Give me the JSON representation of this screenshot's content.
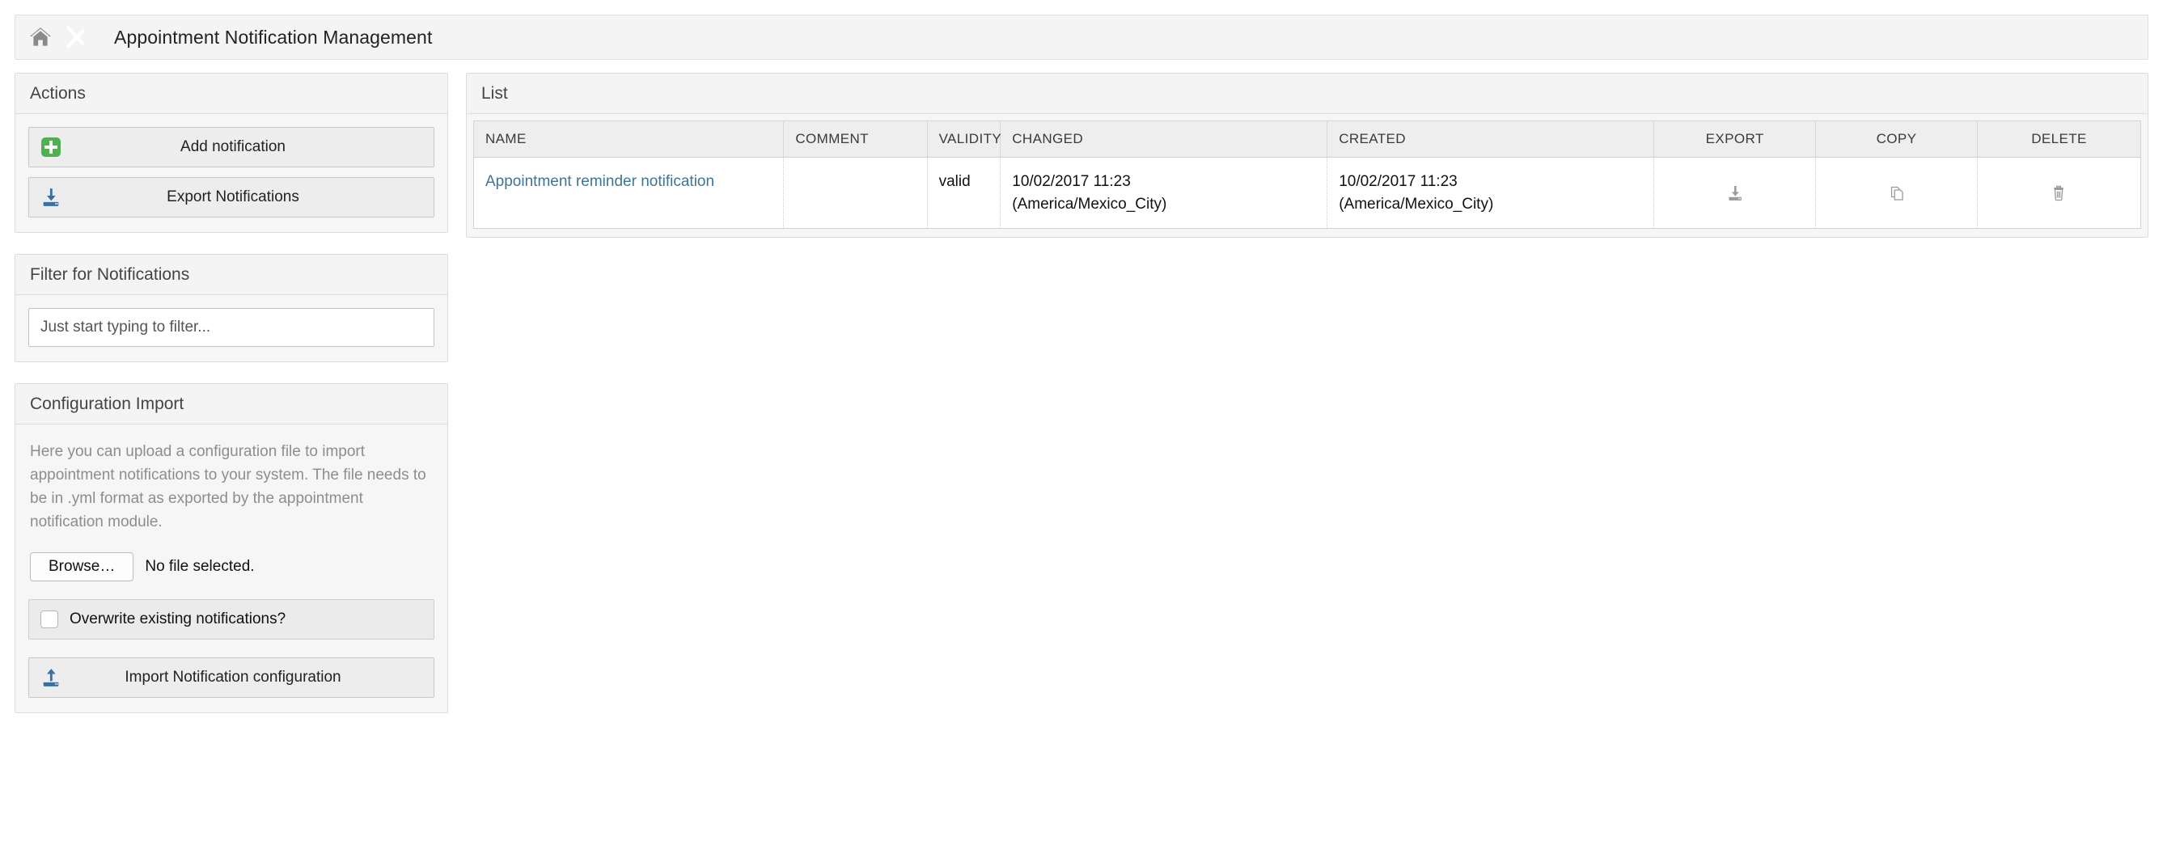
{
  "breadcrumb": {
    "home_icon": "home-icon",
    "title": "Appointment Notification Management"
  },
  "sidebar": {
    "actions": {
      "header": "Actions",
      "buttons": [
        {
          "label": "Add notification",
          "icon": "plus-icon"
        },
        {
          "label": "Export Notifications",
          "icon": "download-tray-icon"
        }
      ]
    },
    "filter": {
      "header": "Filter for Notifications",
      "input_value": "",
      "input_placeholder": "Just start typing to filter..."
    },
    "config_import": {
      "header": "Configuration Import",
      "description": "Here you can upload a configuration file to import appointment notifications to your system. The file needs to be in .yml format as exported by the appointment notification module.",
      "browse_label": "Browse…",
      "file_status": "No file selected.",
      "overwrite_label": "Overwrite existing notifications?",
      "overwrite_checked": false,
      "import_button_label": "Import Notification configuration",
      "import_button_icon": "upload-tray-icon"
    }
  },
  "main": {
    "list": {
      "header": "List",
      "columns": [
        {
          "key": "name",
          "label": "NAME",
          "align": "left"
        },
        {
          "key": "comment",
          "label": "COMMENT",
          "align": "left"
        },
        {
          "key": "validity",
          "label": "VALIDITY",
          "align": "left"
        },
        {
          "key": "changed",
          "label": "CHANGED",
          "align": "left"
        },
        {
          "key": "created",
          "label": "CREATED",
          "align": "left"
        },
        {
          "key": "export",
          "label": "EXPORT",
          "align": "center"
        },
        {
          "key": "copy",
          "label": "COPY",
          "align": "center"
        },
        {
          "key": "delete",
          "label": "DELETE",
          "align": "center"
        }
      ],
      "rows": [
        {
          "name": "Appointment reminder notification",
          "comment": "",
          "validity": "valid",
          "changed_date": "10/02/2017 11:23",
          "changed_zone": "(America/Mexico_City)",
          "created_date": "10/02/2017 11:23",
          "created_zone": "(America/Mexico_City)",
          "export_icon": "download-tray-icon",
          "copy_icon": "copy-pages-icon",
          "delete_icon": "trash-icon"
        }
      ]
    }
  },
  "colors": {
    "accent_green": "#4eb04e",
    "accent_blue": "#3a6f9e",
    "link_blue": "#3f7494",
    "panel_bg": "#f6f6f6",
    "header_bg": "#f4f4f4",
    "icon_gray": "#9a9a9a"
  }
}
